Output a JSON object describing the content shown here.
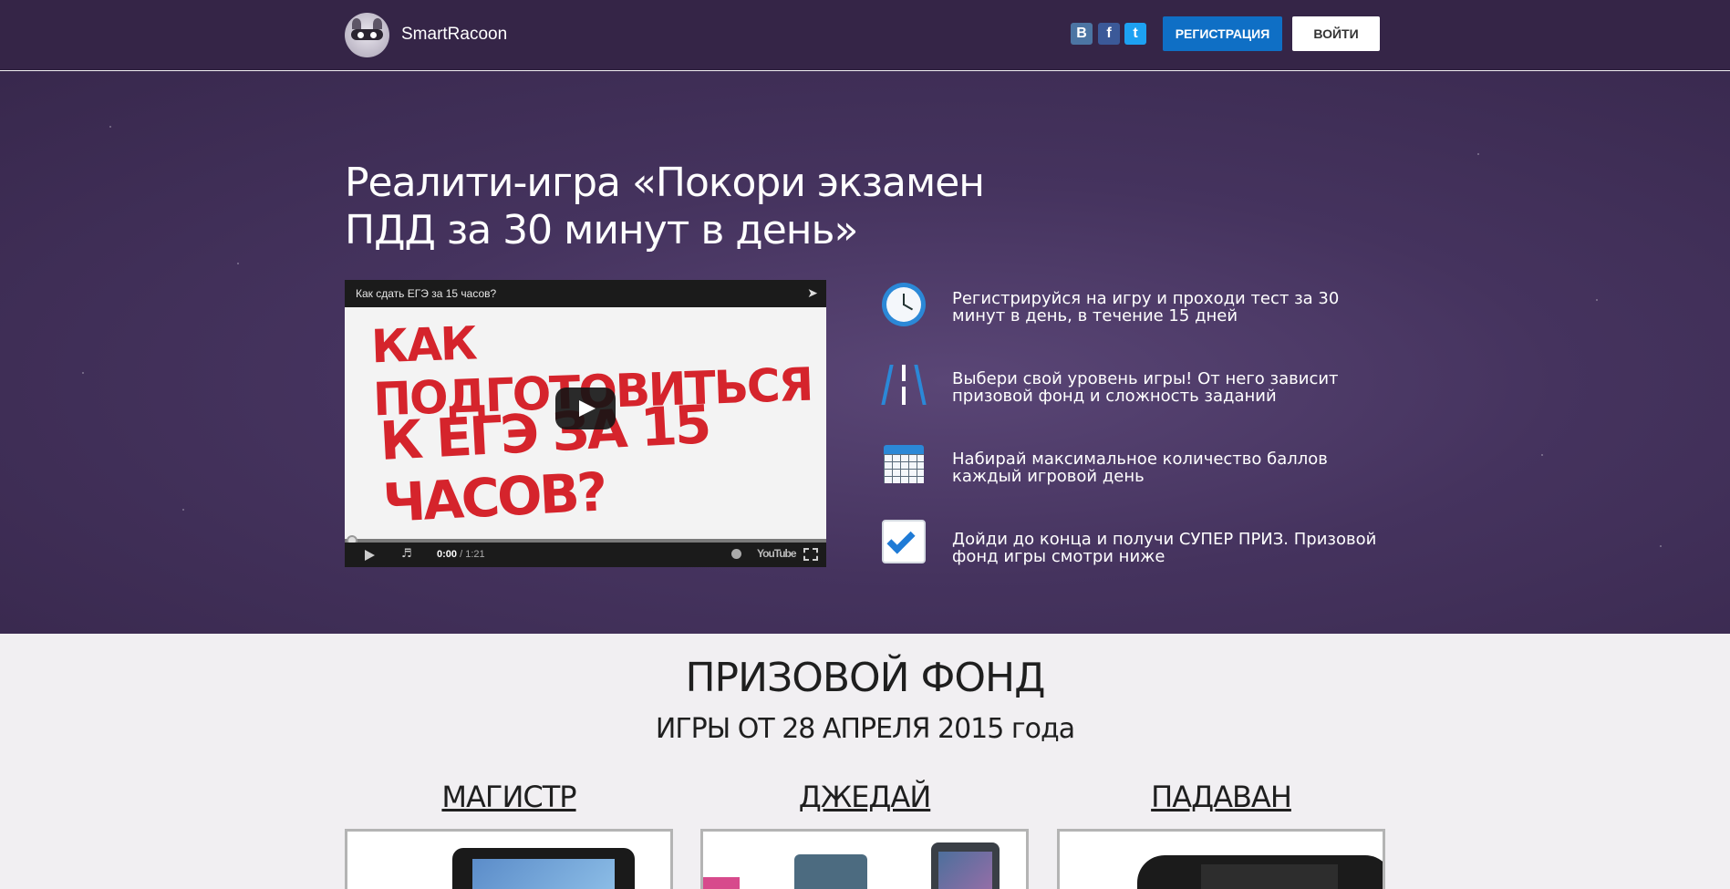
{
  "header": {
    "brand": "SmartRacoon",
    "social": {
      "vk_label": "В",
      "fb_label": "f",
      "tw_label": "t"
    },
    "register_label": "РЕГИСТРАЦИЯ",
    "login_label": "ВОЙТИ"
  },
  "hero": {
    "title": "Реалити-игра «Покори экзамен ПДД за 30 минут в день»",
    "video": {
      "title": "Как сдать ЕГЭ за 15 часов?",
      "art_line1": "Как подготовиться",
      "art_line2": "к ЕГЭ за 15 часов?",
      "time_current": "0:00",
      "time_total": " / 1:21",
      "youtube_label": "YouTube"
    },
    "features": [
      {
        "icon": "clock-icon",
        "text": "Регистрируйся на игру и проходи тест за 30 минут в день, в течение 15 дней"
      },
      {
        "icon": "road-icon",
        "text": "Выбери свой уровень игры! От него зависит призовой фонд и сложность заданий"
      },
      {
        "icon": "calendar-icon",
        "text": "Набирай максимальное количество баллов каждый игровой день"
      },
      {
        "icon": "checkbox-icon",
        "text": "Дойди до конца и получи СУПЕР ПРИЗ. Призовой фонд игры смотри ниже"
      }
    ]
  },
  "prize": {
    "title": "ПРИЗОВОЙ ФОНД",
    "subtitle": "ИГРЫ ОТ 28 АПРЕЛЯ 2015 года",
    "tiers": [
      {
        "label": "МАГИСТР"
      },
      {
        "label": "ДЖЕДАЙ"
      },
      {
        "label": "ПАДАВАН"
      }
    ]
  },
  "colors": {
    "header_bg": "#352547",
    "hero_bg": "#45335e",
    "accent_blue": "#0f6fc5",
    "prize_bg": "#f1eff2"
  }
}
